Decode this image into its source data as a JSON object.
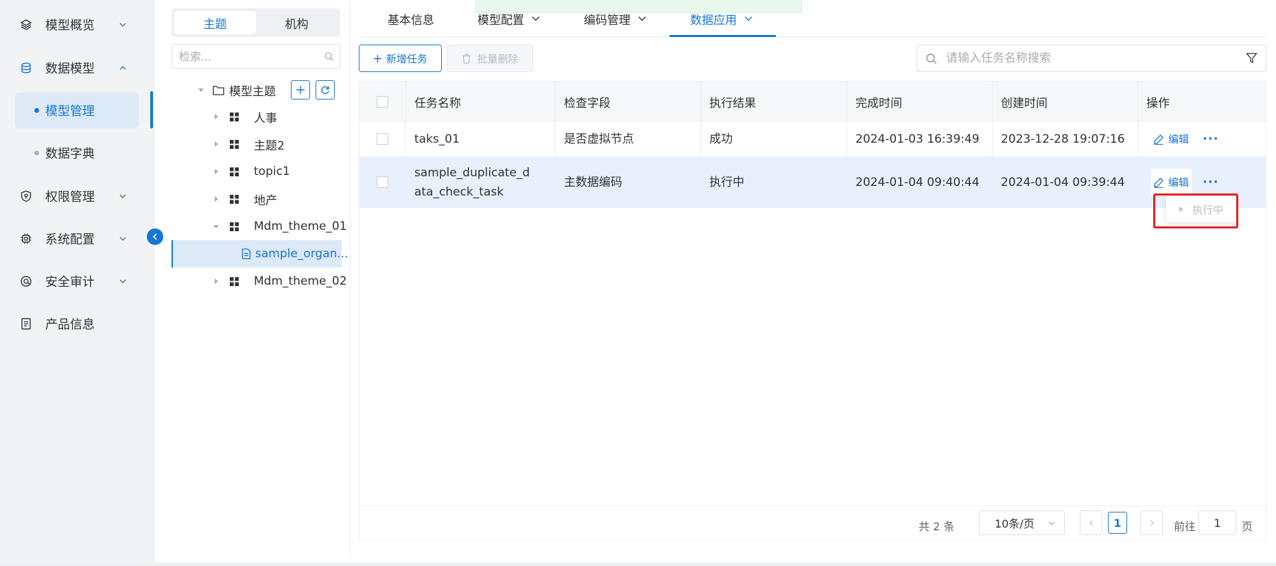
{
  "colors": {
    "primary": "#1677d2",
    "highlight_row": "#e8f0fd",
    "nav_bg": "#f2f3f5",
    "alert_red": "#e5201f"
  },
  "nav": {
    "items": [
      {
        "label": "模型概览",
        "icon": "layers-icon"
      },
      {
        "label": "数据模型",
        "icon": "database-icon"
      },
      {
        "label": "权限管理",
        "icon": "shield-icon"
      },
      {
        "label": "系统配置",
        "icon": "chip-icon"
      },
      {
        "label": "安全审计",
        "icon": "audit-icon"
      },
      {
        "label": "产品信息",
        "icon": "document-icon"
      }
    ],
    "sub_items": [
      {
        "label": "模型管理"
      },
      {
        "label": "数据字典"
      }
    ]
  },
  "tree": {
    "segments": [
      "主题",
      "机构"
    ],
    "search_placeholder": "检索...",
    "root_label": "模型主题",
    "nodes": [
      {
        "label": "人事"
      },
      {
        "label": "主题2"
      },
      {
        "label": "topic1"
      },
      {
        "label": "地产"
      },
      {
        "label": "Mdm_theme_01"
      },
      {
        "label": "sample_organ..."
      },
      {
        "label": "Mdm_theme_02"
      }
    ]
  },
  "tabs": [
    {
      "label": "基本信息"
    },
    {
      "label": "模型配置"
    },
    {
      "label": "编码管理"
    },
    {
      "label": "数据应用"
    }
  ],
  "toolbar": {
    "add_label": "新增任务",
    "delete_label": "批量删除",
    "search_placeholder": "请输入任务名称搜索"
  },
  "table": {
    "headers": [
      "任务名称",
      "检查字段",
      "执行结果",
      "完成时间",
      "创建时间",
      "操作"
    ],
    "rows": [
      {
        "name": "taks_01",
        "field": "是否虚拟节点",
        "result": "成功",
        "finished": "2024-01-03 16:39:49",
        "created": "2023-12-28 19:07:16"
      },
      {
        "name": "sample_duplicate_data_check_task",
        "field": "主数据编码",
        "result": "执行中",
        "finished": "2024-01-04 09:40:44",
        "created": "2024-01-04 09:39:44"
      }
    ],
    "edit_label": "编辑",
    "more_label": "···"
  },
  "popup": {
    "label": "执行中"
  },
  "pagination": {
    "total": "共 2 条",
    "page_size": "10条/页",
    "current_page": "1",
    "goto_label": "前往",
    "goto_value": "1",
    "page_unit": "页"
  }
}
